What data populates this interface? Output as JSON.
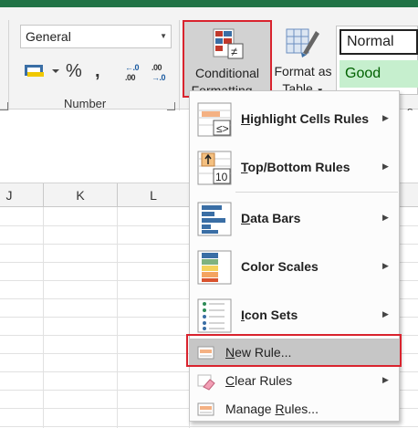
{
  "ribbon": {
    "number_format": {
      "value": "General"
    },
    "number_buttons": {
      "accounting_icon": "accounting-format-icon",
      "percent": "%",
      "comma": ",",
      "increase_decimal": "←.0\n.00",
      "decrease_decimal": ".00\n→.0"
    },
    "number_group_label": "Number",
    "conditional_formatting": {
      "line1": "Conditional",
      "line2": "Formatting"
    },
    "format_as_table": {
      "line1": "Format as",
      "line2": "Table"
    },
    "styles": {
      "normal": "Normal",
      "good": "Good"
    },
    "edge_marker": "s"
  },
  "columns": [
    "J",
    "K",
    "L"
  ],
  "menu": {
    "items": [
      {
        "underline": "H",
        "rest": "ighlight Cells Rules",
        "icon": "highlight-cells-icon",
        "submenu": true
      },
      {
        "underline": "T",
        "rest": "op/Bottom Rules",
        "icon": "top-bottom-icon",
        "submenu": true
      },
      {
        "underline": "D",
        "rest": "ata Bars",
        "icon": "data-bars-icon",
        "submenu": true
      },
      {
        "underline": "S",
        "rest": "Color Scales",
        "icon": "color-scales-icon",
        "submenu": true
      },
      {
        "underline": "I",
        "rest": "con Sets",
        "icon": "icon-sets-icon",
        "submenu": true
      }
    ],
    "new_rule": {
      "underline": "N",
      "rest": "ew Rule..."
    },
    "clear_rules": {
      "underline": "C",
      "rest": "lear Rules"
    },
    "manage_rules": {
      "before": "Manage ",
      "underline": "R",
      "rest": "ules..."
    }
  },
  "colors": {
    "excel_green": "#217346",
    "highlight_red": "#d9232e",
    "good_fill": "#c6efce",
    "good_text": "#006100"
  }
}
